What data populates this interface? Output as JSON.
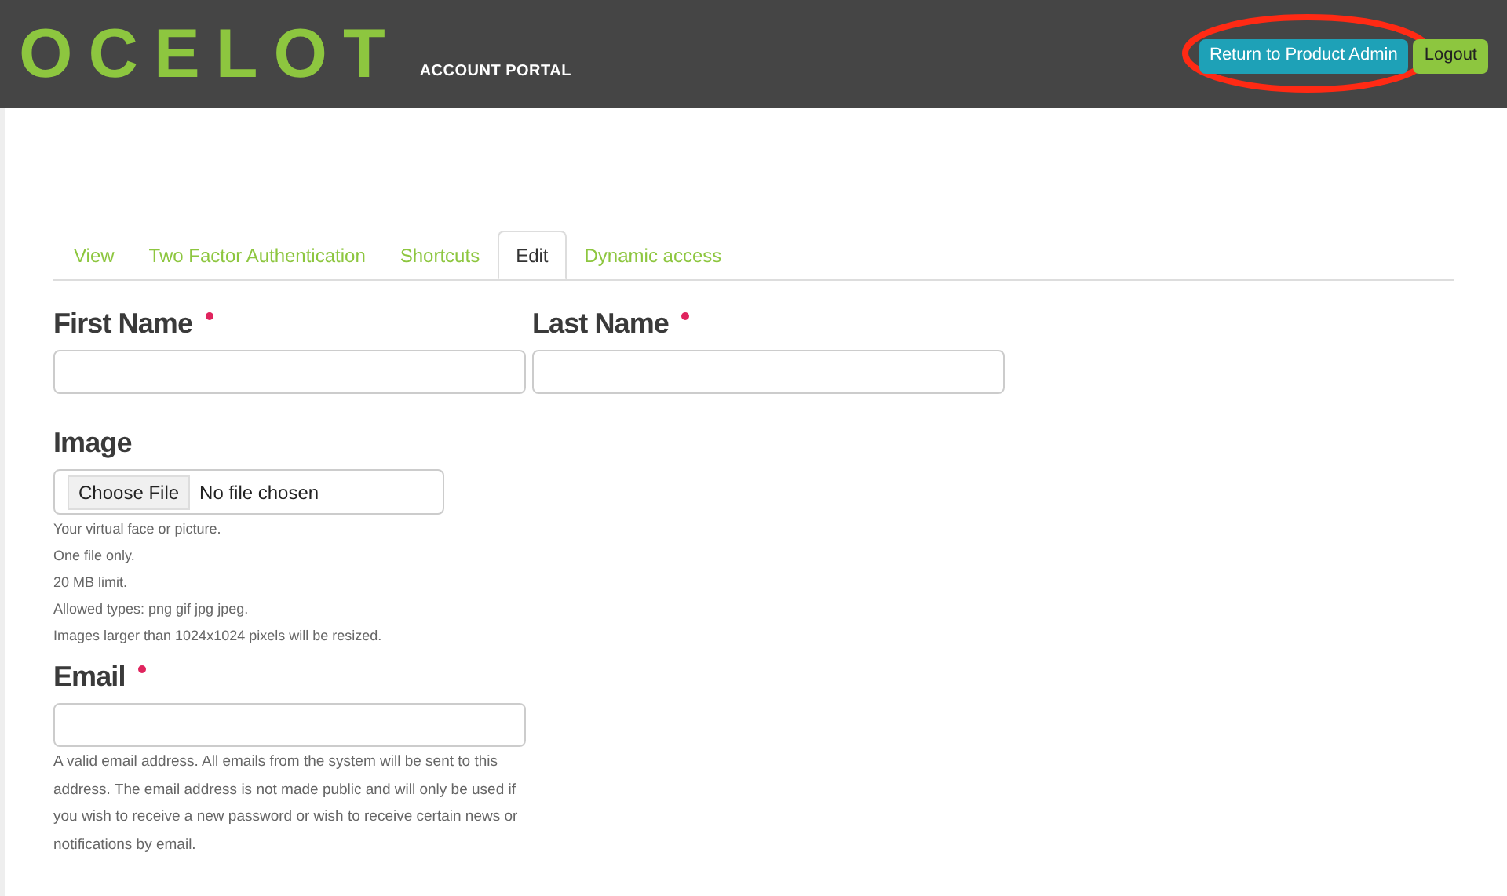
{
  "header": {
    "logo": "OCELOT",
    "subtitle": "ACCOUNT PORTAL",
    "buttons": [
      {
        "label": "Return to Product Admin",
        "kind": "primary",
        "highlighted": true
      },
      {
        "label": "Logout",
        "kind": "secondary",
        "highlighted": false
      }
    ]
  },
  "tabs": [
    {
      "label": "View",
      "selected": false
    },
    {
      "label": "Two Factor Authentication",
      "selected": false
    },
    {
      "label": "Shortcuts",
      "selected": false
    },
    {
      "label": "Edit",
      "selected": true
    },
    {
      "label": "Dynamic access",
      "selected": false
    }
  ],
  "name_fields": [
    {
      "label": "First Name",
      "required": true
    },
    {
      "label": "Last Name",
      "required": true
    }
  ],
  "image": {
    "label": "Image",
    "button": "Choose File",
    "status": "No file chosen",
    "help": [
      "Your virtual face or picture.",
      "One file only.",
      "20 MB limit.",
      "Allowed types: png gif jpg jpeg.",
      "Images larger than 1024x1024 pixels will be resized."
    ]
  },
  "email": {
    "label": "Email",
    "required": true,
    "help": "A valid email address. All emails from the system will be sent to this address. The email address is not made public and will only be used if you wish to receive a new password or wish to receive certain news or notifications by email."
  }
}
